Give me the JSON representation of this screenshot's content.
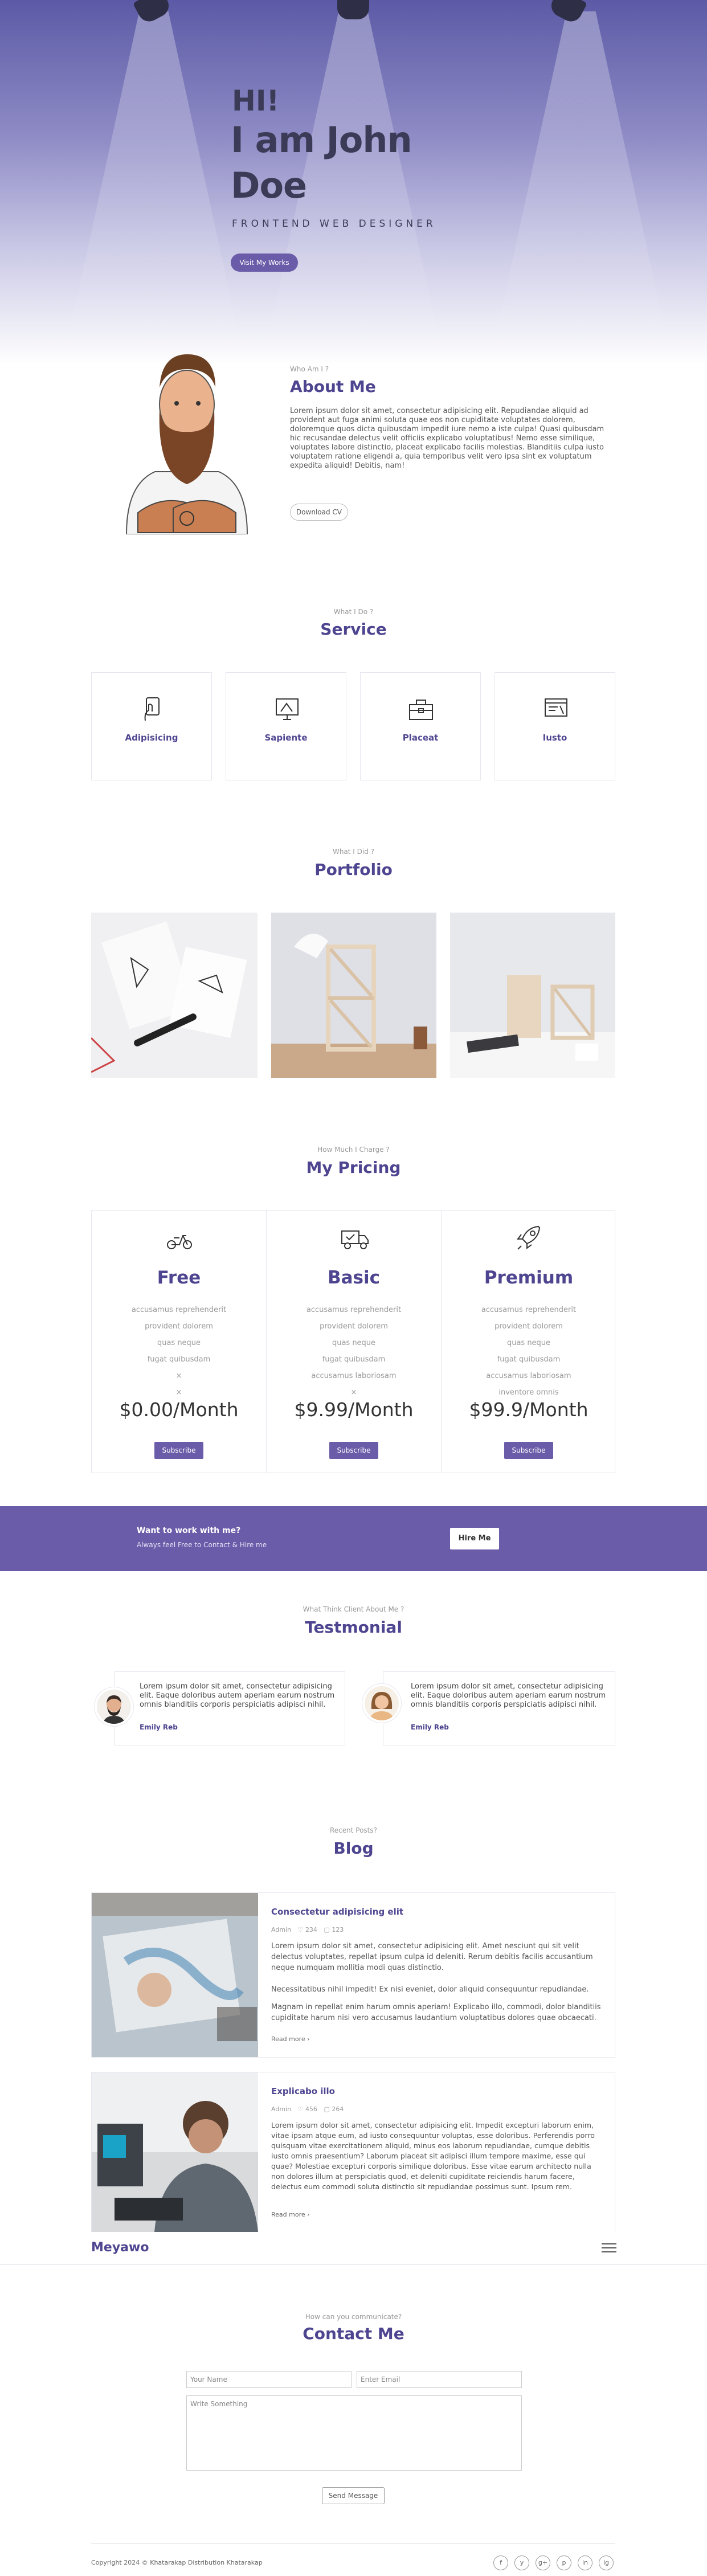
{
  "hero": {
    "greeting": "HI!",
    "name": "I am John Doe",
    "role": "FRONTEND WEB DESIGNER",
    "cta": "Visit My Works"
  },
  "about": {
    "sub": "Who Am I ?",
    "title": "About Me",
    "text": "Lorem ipsum dolor sit amet, consectetur adipisicing elit. Repudiandae aliquid ad provident aut fuga animi soluta quae eos non cupiditate voluptates dolorem, doloremque quos dicta quibusdam impedit iure nemo a iste culpa! Quasi quibusdam hic recusandae delectus velit officiis explicabo voluptatibus! Nemo esse similique, voluptates labore distinctio, placeat explicabo facilis molestias. Blanditiis culpa iusto voluptatem ratione eligendi a, quia temporibus velit vero ipsa sint ex voluptatum expedita aliquid! Debitis, nam!",
    "button": "Download CV"
  },
  "service": {
    "sub": "What I Do ?",
    "title": "Service",
    "items": [
      {
        "label": "Adipisicing",
        "icon": "touch-screen-icon"
      },
      {
        "label": "Sapiente",
        "icon": "design-tools-icon"
      },
      {
        "label": "Placeat",
        "icon": "toolbox-icon"
      },
      {
        "label": "Iusto",
        "icon": "web-design-icon"
      }
    ]
  },
  "portfolio": {
    "sub": "What I Did ?",
    "title": "Portfolio"
  },
  "pricing": {
    "sub": "How Much I Charge ?",
    "title": "My Pricing",
    "plans": [
      {
        "name": "Free",
        "icon": "scooter-icon",
        "features": [
          "accusamus reprehenderit",
          "provident dolorem",
          "quas neque",
          "fugat quibusdam",
          "×",
          "×"
        ],
        "price": "$0.00/Month",
        "button": "Subscribe"
      },
      {
        "name": "Basic",
        "icon": "delivery-truck-icon",
        "features": [
          "accusamus reprehenderit",
          "provident dolorem",
          "quas neque",
          "fugat quibusdam",
          "accusamus laboriosam",
          "×"
        ],
        "price": "$9.99/Month",
        "button": "Subscribe"
      },
      {
        "name": "Premium",
        "icon": "rocket-icon",
        "features": [
          "accusamus reprehenderit",
          "provident dolorem",
          "quas neque",
          "fugat quibusdam",
          "accusamus laboriosam",
          "inventore omnis"
        ],
        "price": "$99.9/Month",
        "button": "Subscribe"
      }
    ]
  },
  "hire": {
    "title": "Want to work with me?",
    "text": "Always feel Free to Contact & Hire me",
    "button": "Hire Me"
  },
  "testimonial": {
    "sub": "What Think Client About Me ?",
    "title": "Testmonial",
    "items": [
      {
        "text": "Lorem ipsum dolor sit amet, consectetur adipisicing elit. Eaque doloribus autem aperiam earum nostrum omnis blanditiis corporis perspiciatis adipisci nihil.",
        "name": "Emily Reb"
      },
      {
        "text": "Lorem ipsum dolor sit amet, consectetur adipisicing elit. Eaque doloribus autem aperiam earum nostrum omnis blanditiis corporis perspiciatis adipisci nihil.",
        "name": "Emily Reb"
      }
    ]
  },
  "blog": {
    "sub": "Recent Posts?",
    "title": "Blog",
    "posts": [
      {
        "title": "Consectetur adipisicing elit",
        "author": "Admin",
        "likes": "234",
        "comments": "123",
        "p1": "Lorem ipsum dolor sit amet, consectetur adipisicing elit. Amet nesciunt qui sit velit delectus voluptates, repellat ipsum culpa id deleniti. Rerum debitis facilis accusantium neque numquam mollitia modi quas distinctio.",
        "p2": "Necessitatibus nihil impedit! Ex nisi eveniet, dolor aliquid consequuntur repudiandae.",
        "p3": "Magnam in repellat enim harum omnis aperiam! Explicabo illo, commodi, dolor blanditiis cupiditate harum nisi vero accusamus laudantium voluptatibus dolores quae obcaecati.",
        "more": "Read more"
      },
      {
        "title": "Explicabo illo",
        "author": "Admin",
        "likes": "456",
        "comments": "264",
        "p1": "Lorem ipsum dolor sit amet, consectetur adipisicing elit. Impedit excepturi laborum enim, vitae ipsam atque eum, ad iusto consequuntur voluptas, esse doloribus. Perferendis porro quisquam vitae exercitationem aliquid, minus eos laborum repudiandae, cumque debitis iusto omnis praesentium? Laborum placeat sit adipisci illum tempore maxime, esse qui quae? Molestiae excepturi corporis similique doloribus. Esse vitae earum architecto nulla non dolores illum at perspiciatis quod, et deleniti cupiditate reiciendis harum facere, delectus eum commodi soluta distinctio sit repudiandae possimus sunt. Ipsum rem.",
        "more": "Read more"
      }
    ]
  },
  "nav": {
    "brand": "Meyawo"
  },
  "contact": {
    "sub": "How can you communicate?",
    "title": "Contact Me",
    "name_ph": "Your Name",
    "email_ph": "Enter Email",
    "message_ph": "Write Something",
    "button": "Send Message"
  },
  "footer": {
    "copyright": "Copyright 2024 © Khatarakap Distribution Khatarakap",
    "social": [
      "f",
      "y",
      "g+",
      "p",
      "in",
      "ig"
    ]
  },
  "colors": {
    "accent": "#6a5ca8",
    "heading": "#4d4590"
  }
}
